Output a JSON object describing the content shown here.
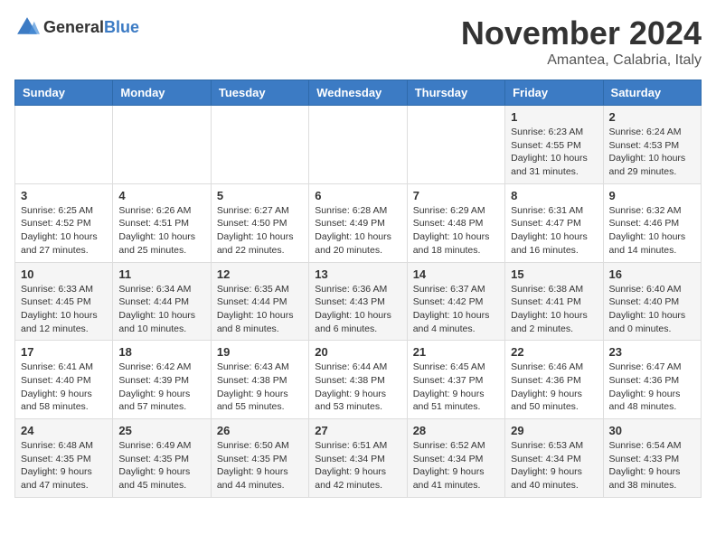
{
  "header": {
    "logo_general": "General",
    "logo_blue": "Blue",
    "month_title": "November 2024",
    "location": "Amantea, Calabria, Italy"
  },
  "days_of_week": [
    "Sunday",
    "Monday",
    "Tuesday",
    "Wednesday",
    "Thursday",
    "Friday",
    "Saturday"
  ],
  "weeks": [
    [
      {
        "day": "",
        "info": ""
      },
      {
        "day": "",
        "info": ""
      },
      {
        "day": "",
        "info": ""
      },
      {
        "day": "",
        "info": ""
      },
      {
        "day": "",
        "info": ""
      },
      {
        "day": "1",
        "info": "Sunrise: 6:23 AM\nSunset: 4:55 PM\nDaylight: 10 hours and 31 minutes."
      },
      {
        "day": "2",
        "info": "Sunrise: 6:24 AM\nSunset: 4:53 PM\nDaylight: 10 hours and 29 minutes."
      }
    ],
    [
      {
        "day": "3",
        "info": "Sunrise: 6:25 AM\nSunset: 4:52 PM\nDaylight: 10 hours and 27 minutes."
      },
      {
        "day": "4",
        "info": "Sunrise: 6:26 AM\nSunset: 4:51 PM\nDaylight: 10 hours and 25 minutes."
      },
      {
        "day": "5",
        "info": "Sunrise: 6:27 AM\nSunset: 4:50 PM\nDaylight: 10 hours and 22 minutes."
      },
      {
        "day": "6",
        "info": "Sunrise: 6:28 AM\nSunset: 4:49 PM\nDaylight: 10 hours and 20 minutes."
      },
      {
        "day": "7",
        "info": "Sunrise: 6:29 AM\nSunset: 4:48 PM\nDaylight: 10 hours and 18 minutes."
      },
      {
        "day": "8",
        "info": "Sunrise: 6:31 AM\nSunset: 4:47 PM\nDaylight: 10 hours and 16 minutes."
      },
      {
        "day": "9",
        "info": "Sunrise: 6:32 AM\nSunset: 4:46 PM\nDaylight: 10 hours and 14 minutes."
      }
    ],
    [
      {
        "day": "10",
        "info": "Sunrise: 6:33 AM\nSunset: 4:45 PM\nDaylight: 10 hours and 12 minutes."
      },
      {
        "day": "11",
        "info": "Sunrise: 6:34 AM\nSunset: 4:44 PM\nDaylight: 10 hours and 10 minutes."
      },
      {
        "day": "12",
        "info": "Sunrise: 6:35 AM\nSunset: 4:44 PM\nDaylight: 10 hours and 8 minutes."
      },
      {
        "day": "13",
        "info": "Sunrise: 6:36 AM\nSunset: 4:43 PM\nDaylight: 10 hours and 6 minutes."
      },
      {
        "day": "14",
        "info": "Sunrise: 6:37 AM\nSunset: 4:42 PM\nDaylight: 10 hours and 4 minutes."
      },
      {
        "day": "15",
        "info": "Sunrise: 6:38 AM\nSunset: 4:41 PM\nDaylight: 10 hours and 2 minutes."
      },
      {
        "day": "16",
        "info": "Sunrise: 6:40 AM\nSunset: 4:40 PM\nDaylight: 10 hours and 0 minutes."
      }
    ],
    [
      {
        "day": "17",
        "info": "Sunrise: 6:41 AM\nSunset: 4:40 PM\nDaylight: 9 hours and 58 minutes."
      },
      {
        "day": "18",
        "info": "Sunrise: 6:42 AM\nSunset: 4:39 PM\nDaylight: 9 hours and 57 minutes."
      },
      {
        "day": "19",
        "info": "Sunrise: 6:43 AM\nSunset: 4:38 PM\nDaylight: 9 hours and 55 minutes."
      },
      {
        "day": "20",
        "info": "Sunrise: 6:44 AM\nSunset: 4:38 PM\nDaylight: 9 hours and 53 minutes."
      },
      {
        "day": "21",
        "info": "Sunrise: 6:45 AM\nSunset: 4:37 PM\nDaylight: 9 hours and 51 minutes."
      },
      {
        "day": "22",
        "info": "Sunrise: 6:46 AM\nSunset: 4:36 PM\nDaylight: 9 hours and 50 minutes."
      },
      {
        "day": "23",
        "info": "Sunrise: 6:47 AM\nSunset: 4:36 PM\nDaylight: 9 hours and 48 minutes."
      }
    ],
    [
      {
        "day": "24",
        "info": "Sunrise: 6:48 AM\nSunset: 4:35 PM\nDaylight: 9 hours and 47 minutes."
      },
      {
        "day": "25",
        "info": "Sunrise: 6:49 AM\nSunset: 4:35 PM\nDaylight: 9 hours and 45 minutes."
      },
      {
        "day": "26",
        "info": "Sunrise: 6:50 AM\nSunset: 4:35 PM\nDaylight: 9 hours and 44 minutes."
      },
      {
        "day": "27",
        "info": "Sunrise: 6:51 AM\nSunset: 4:34 PM\nDaylight: 9 hours and 42 minutes."
      },
      {
        "day": "28",
        "info": "Sunrise: 6:52 AM\nSunset: 4:34 PM\nDaylight: 9 hours and 41 minutes."
      },
      {
        "day": "29",
        "info": "Sunrise: 6:53 AM\nSunset: 4:34 PM\nDaylight: 9 hours and 40 minutes."
      },
      {
        "day": "30",
        "info": "Sunrise: 6:54 AM\nSunset: 4:33 PM\nDaylight: 9 hours and 38 minutes."
      }
    ]
  ]
}
